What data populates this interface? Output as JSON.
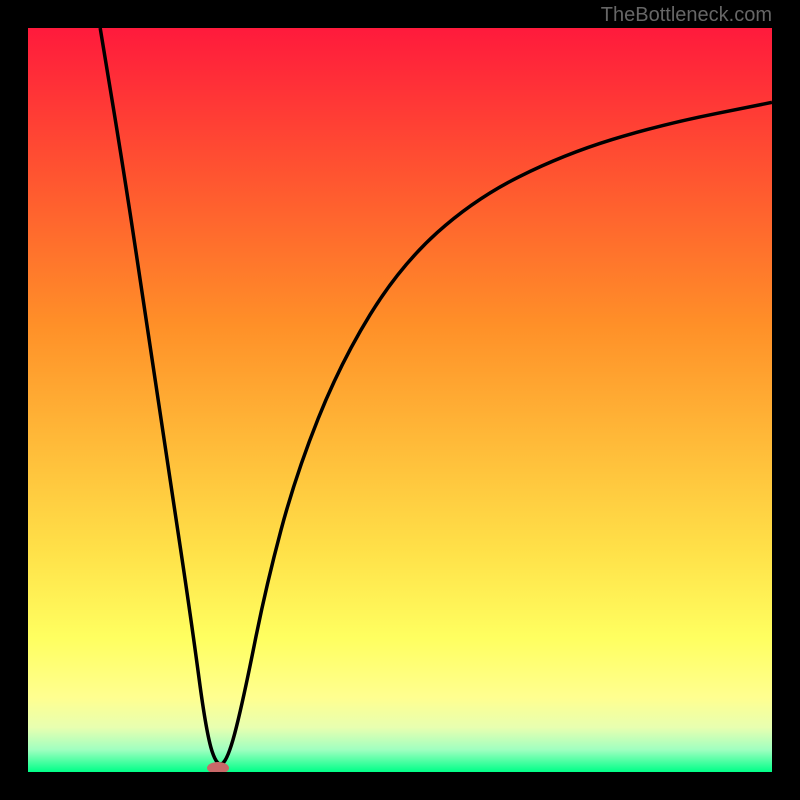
{
  "watermark": "TheBottleneck.com",
  "chart_data": {
    "type": "line",
    "title": "",
    "xlabel": "",
    "ylabel": "",
    "xlim": [
      0,
      100
    ],
    "ylim": [
      0,
      100
    ],
    "gradient_colors": {
      "top": "#ff1a3c",
      "upper_mid": "#ff7b2a",
      "mid": "#ffc040",
      "lower_mid": "#ffe850",
      "lower": "#ffff80",
      "near_bottom": "#d3ffaa",
      "bottom": "#00ff88"
    },
    "curve_points": [
      {
        "x": 9.7,
        "y": 100
      },
      {
        "x": 13,
        "y": 80
      },
      {
        "x": 16,
        "y": 60
      },
      {
        "x": 19,
        "y": 40
      },
      {
        "x": 22,
        "y": 20
      },
      {
        "x": 24,
        "y": 5
      },
      {
        "x": 25.5,
        "y": 0.5
      },
      {
        "x": 27,
        "y": 2
      },
      {
        "x": 29,
        "y": 10
      },
      {
        "x": 32,
        "y": 25
      },
      {
        "x": 36,
        "y": 40
      },
      {
        "x": 42,
        "y": 55
      },
      {
        "x": 50,
        "y": 68
      },
      {
        "x": 60,
        "y": 77
      },
      {
        "x": 72,
        "y": 83
      },
      {
        "x": 85,
        "y": 87
      },
      {
        "x": 100,
        "y": 90
      }
    ],
    "marker": {
      "x": 25.5,
      "y": 0.5,
      "color": "#c96969"
    }
  }
}
